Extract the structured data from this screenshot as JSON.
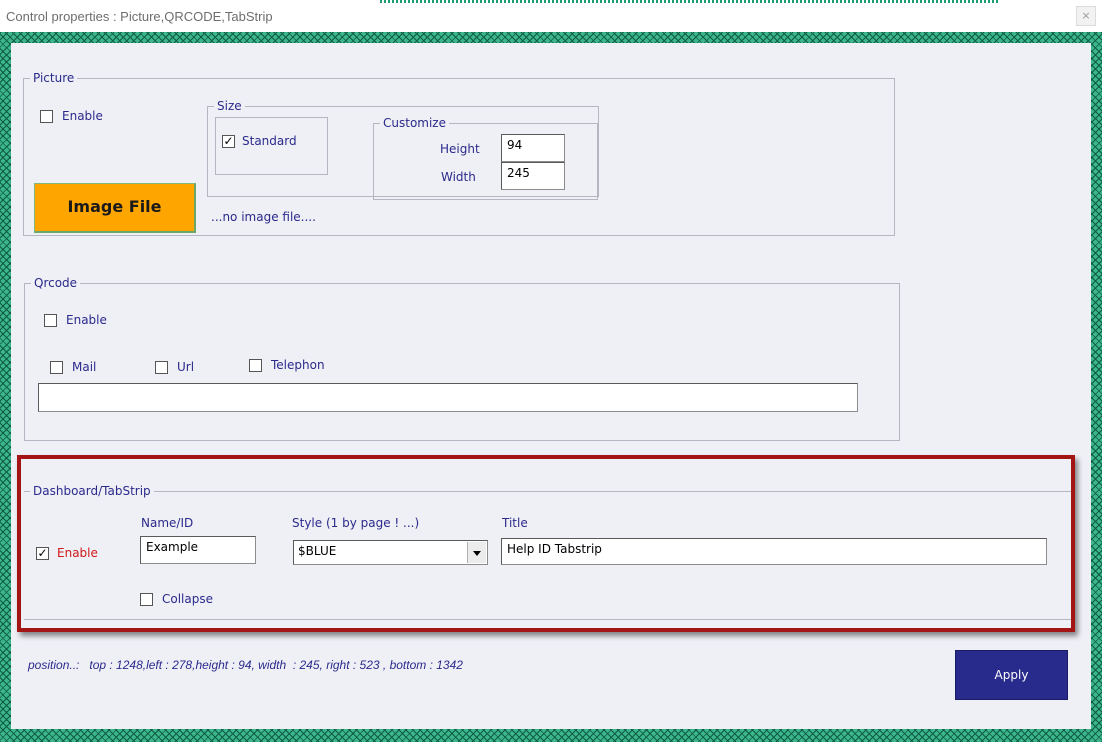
{
  "window": {
    "title": "Control properties : Picture,QRCODE,TabStrip",
    "close_symbol": "×"
  },
  "picture": {
    "legend": "Picture",
    "enable_label": "Enable",
    "enable_checked": false,
    "image_button_label": "Image File",
    "no_image_text": "...no image file....",
    "size": {
      "legend": "Size",
      "standard_label": "Standard",
      "standard_checked": true,
      "customize": {
        "legend": "Customize",
        "height_label": "Height",
        "height_value": "94",
        "width_label": "Width",
        "width_value": "245"
      }
    }
  },
  "qrcode": {
    "legend": "Qrcode",
    "enable_label": "Enable",
    "enable_checked": false,
    "mail_label": "Mail",
    "mail_checked": false,
    "url_label": "Url",
    "url_checked": false,
    "telephon_label": "Telephon",
    "telephon_checked": false,
    "value": ""
  },
  "tabstrip": {
    "legend": "Dashboard/TabStrip",
    "enable_label": "Enable",
    "enable_checked": true,
    "name_header": "Name/ID",
    "name_value": "Example",
    "style_header": "Style (1 by page ! ...)",
    "style_value": "$BLUE",
    "title_header": "Title",
    "title_value": "Help ID Tabstrip",
    "collapse_label": "Collapse",
    "collapse_checked": false
  },
  "footer": {
    "position_text": "position..:   top : 1248,left : 278,height : 94, width  : 245, right : 523 , bottom : 1342",
    "apply_label": "Apply"
  },
  "colors": {
    "highlight_border": "#a31414",
    "image_button": "#ffa500",
    "apply_button": "#282a8c",
    "label_text": "#2a2a8c",
    "enable_red": "#d01818",
    "frame_green": "#3cb58a"
  },
  "checkmark": "✓"
}
